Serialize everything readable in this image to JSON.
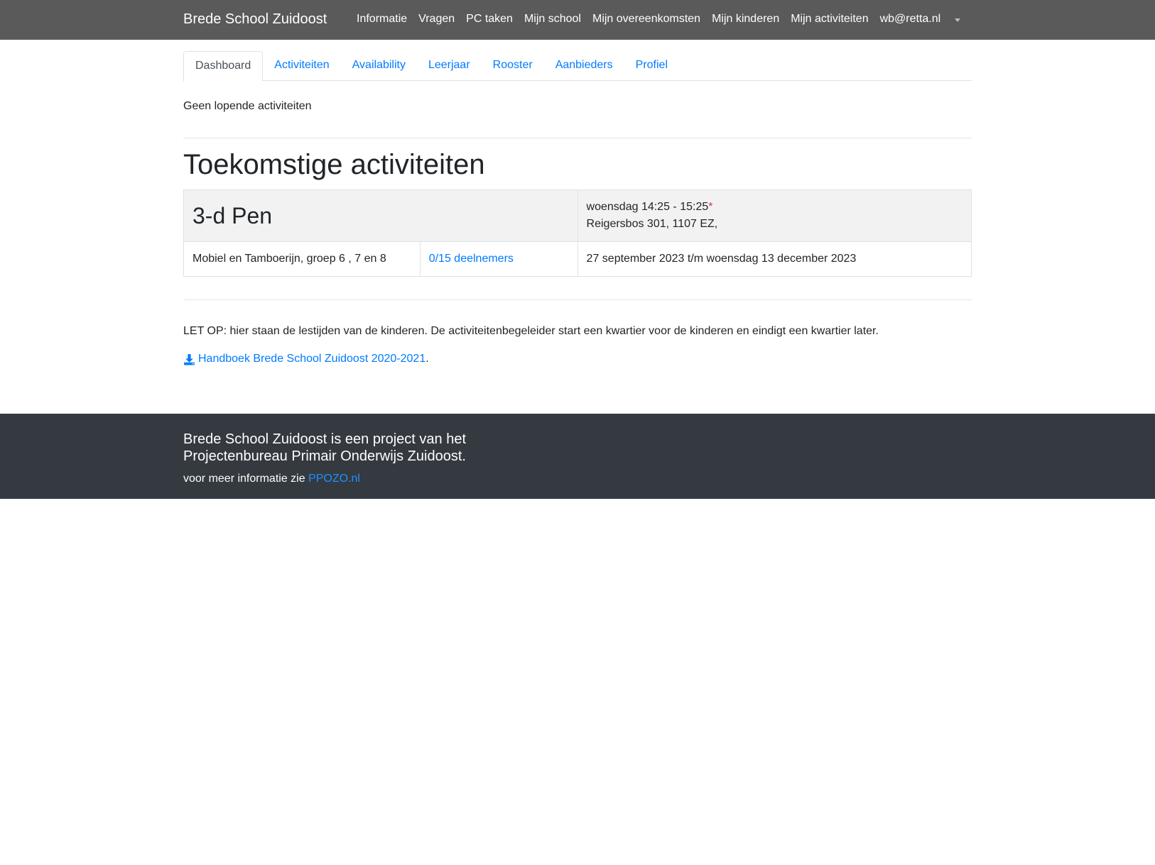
{
  "navbar": {
    "brand": "Brede School Zuidoost",
    "items": [
      "Informatie",
      "Vragen",
      "PC taken",
      "Mijn school",
      "Mijn overeenkomsten",
      "Mijn kinderen",
      "Mijn activiteiten",
      "wb@retta.nl"
    ]
  },
  "tabs": [
    "Dashboard",
    "Activiteiten",
    "Availability",
    "Leerjaar",
    "Rooster",
    "Aanbieders",
    "Profiel"
  ],
  "dashboard": {
    "no_running": "Geen lopende activiteiten",
    "heading": "Toekomstige activiteiten",
    "activity": {
      "title": "3-d Pen",
      "schedule": "woensdag 14:25 - 15:25",
      "schedule_marker": "*",
      "address": "Reigersbos 301, 1107 EZ,",
      "groups": "Mobiel en Tamboerijn, groep 6 , 7 en 8",
      "participants": "0/15 deelnemers",
      "period": "27 september 2023 t/m woensdag 13 december 2023"
    },
    "note": "LET OP: hier staan de lestijden van de kinderen. De activiteitenbegeleider start een kwartier voor de kinderen en eindigt een kwartier later.",
    "handbook_label": "Handboek Brede School Zuidoost 2020-2021",
    "handbook_suffix": "."
  },
  "footer": {
    "line1": "Brede School Zuidoost is een project van het",
    "line2": "Projectenbureau Primair Onderwijs Zuidoost.",
    "more_prefix": "voor meer informatie zie ",
    "more_link": "PPOZO.nl"
  },
  "colors": {
    "navbar": "#5a5a5a",
    "footer": "#343a40",
    "link": "#007bff",
    "required": "#dc3545"
  }
}
